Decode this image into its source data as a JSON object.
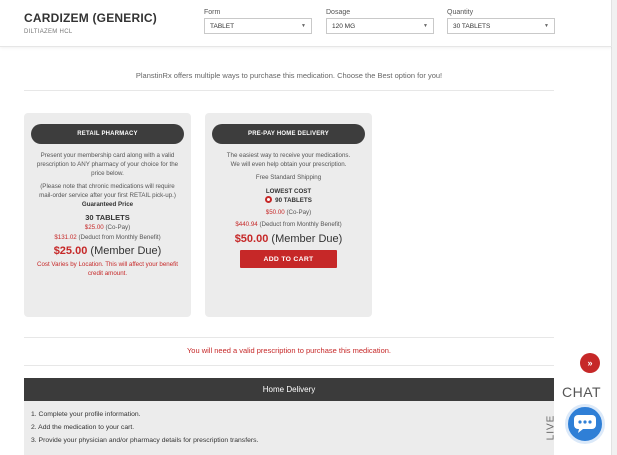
{
  "product": {
    "name": "CARDIZEM (GENERIC)",
    "generic": "DILTIAZEM HCL"
  },
  "selectors": {
    "form": {
      "label": "Form",
      "value": "TABLET"
    },
    "dosage": {
      "label": "Dosage",
      "value": "120 MG"
    },
    "quantity": {
      "label": "Quantity",
      "value": "30 TABLETS"
    }
  },
  "intro": "PlanstinRx offers multiple ways to purchase this medication. Choose the Best option for you!",
  "retail": {
    "title": "RETAIL PHARMACY",
    "desc": "Present your membership card along with a valid prescription to ANY pharmacy of your choice for the price below.",
    "note": "(Please note that chronic medications will require mail-order service after your first RETAIL pick-up.)",
    "guaranteed": "Guaranteed Price",
    "qty": "30 TABLETS",
    "copay_amount": "$25.00",
    "copay_label": "(Co-Pay)",
    "deduct_amount": "$131.02",
    "deduct_label": "(Deduct from Monthly Benefit)",
    "member_amount": "$25.00",
    "member_label": "(Member Due)",
    "varies": "Cost Varies by Location. This will affect your benefit credit amount."
  },
  "delivery": {
    "title": "PRE-PAY HOME DELIVERY",
    "desc": "The easiest way to receive your medications. We will even help obtain your prescription.",
    "shipping": "Free Standard Shipping",
    "lowest": "LOWEST COST",
    "option": "90 TABLETS",
    "copay_amount": "$50.00",
    "copay_label": "(Co-Pay)",
    "deduct_amount": "$440.94",
    "deduct_label": "(Deduct from Monthly Benefit)",
    "member_amount": "$50.00",
    "member_label": "(Member Due)",
    "button": "ADD TO CART"
  },
  "rx_note": "You will need a valid prescription to purchase this medication.",
  "home_delivery": {
    "title": "Home Delivery",
    "steps": [
      "1.  Complete your profile information.",
      "2.  Add the medication to your cart.",
      "3.  Provide your physician and/or pharmacy details for prescription transfers."
    ]
  },
  "chat": {
    "live": "LIVE",
    "chat": "CHAT"
  },
  "colors": {
    "accent": "#c62828",
    "dark": "#3b3b3b",
    "card": "#ececec",
    "chat": "#2f7fd6"
  },
  "icons": {
    "scroll_top": "double-chevron-up-icon",
    "chat": "chat-bubble-icon",
    "dropdown": "caret-down-icon",
    "radio": "radio-selected-icon"
  }
}
